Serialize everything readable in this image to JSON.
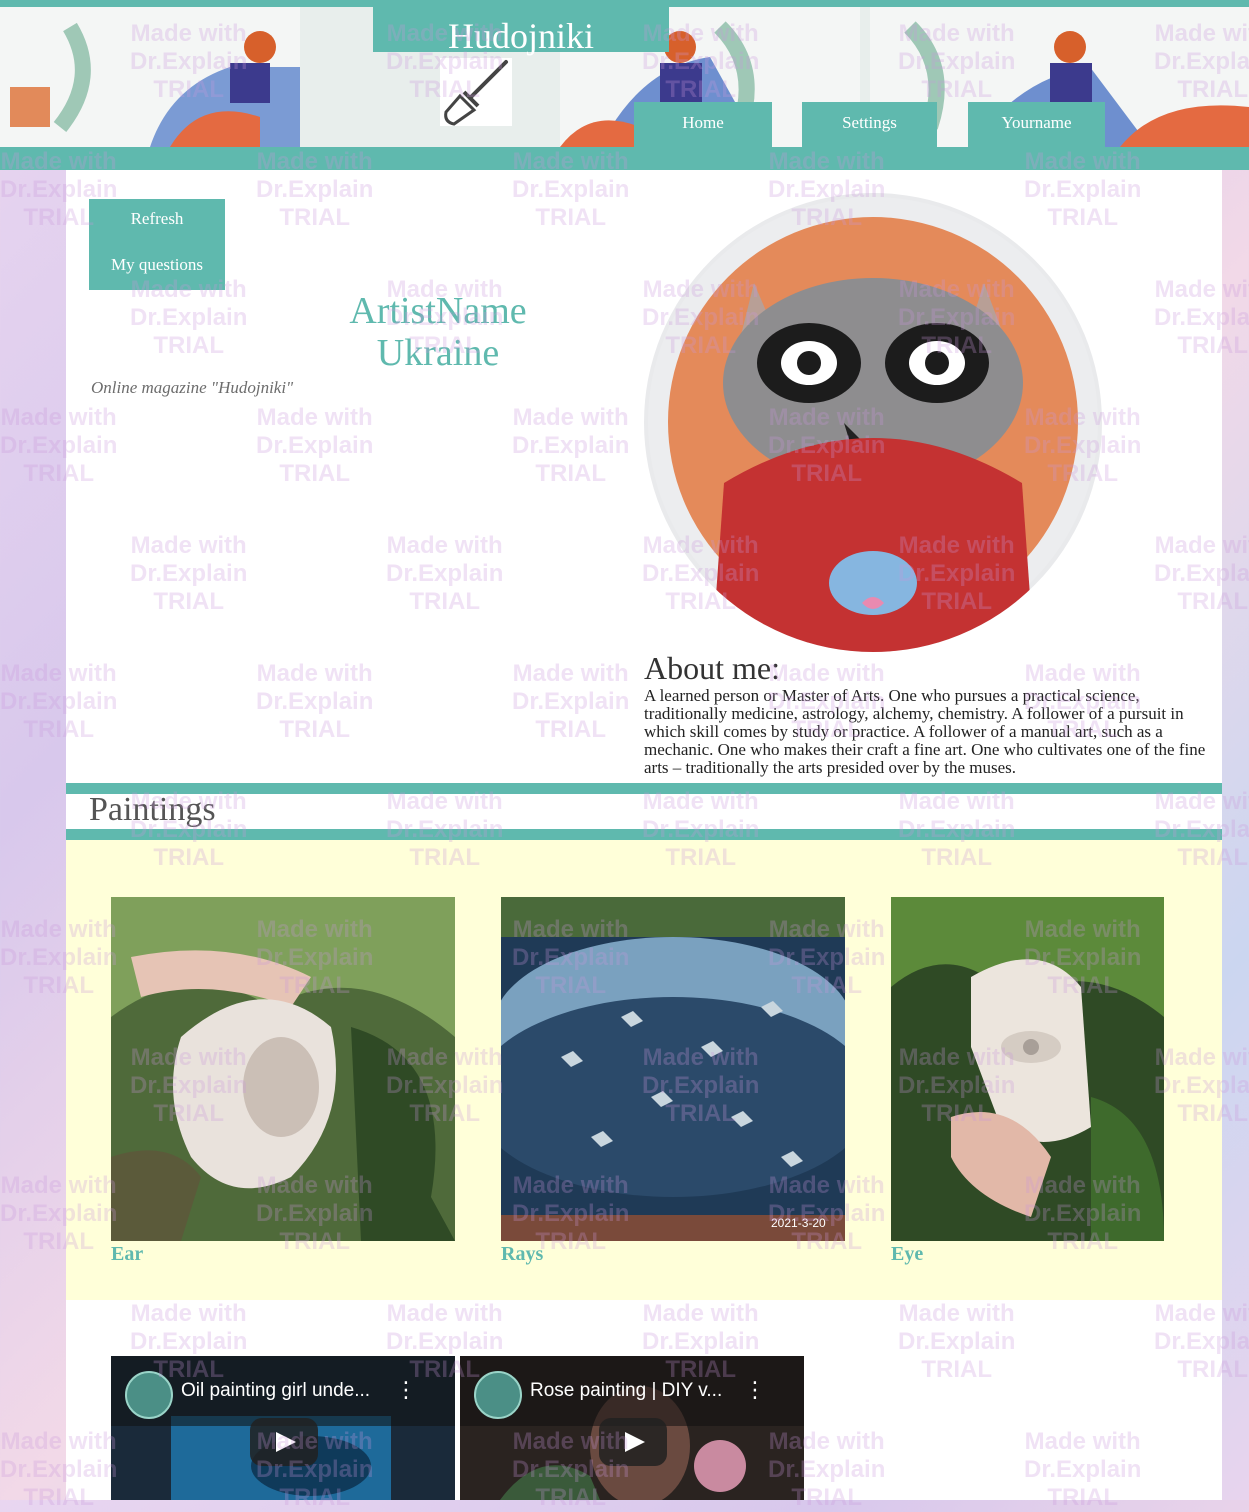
{
  "header": {
    "site_title": "Hudojniki",
    "nav": [
      {
        "label": "Home"
      },
      {
        "label": "Settings"
      },
      {
        "label": "Yourname"
      }
    ]
  },
  "sidebar": {
    "items": [
      {
        "label": "Refresh"
      },
      {
        "label": "My questions"
      }
    ]
  },
  "profile": {
    "artist_name": "ArtistName",
    "country": "Ukraine",
    "magazine": "Online magazine \"Hudojniki\""
  },
  "about": {
    "title": "About me:",
    "text": "A learned person or Master of Arts. One who pursues a practical science, traditionally medicine, astrology, alchemy, chemistry. A follower of a pursuit in which skill comes by study or practice. A follower of a manual art, such as a mechanic. One who makes their craft a fine art. One who cultivates one of the fine arts – traditionally the arts presided over by the muses."
  },
  "paintings": {
    "title": "Paintings",
    "items": [
      {
        "caption": "Ear"
      },
      {
        "caption": "Rays",
        "stamp": "2021-3-20"
      },
      {
        "caption": "Eye"
      }
    ]
  },
  "videos": [
    {
      "title": "Oil painting girl unde..."
    },
    {
      "title": "Rose painting | DIY v..."
    }
  ],
  "watermark": {
    "line1": "Made with",
    "line2": "Dr.Explain",
    "line3": "TRIAL"
  },
  "colors": {
    "accent": "#5fb9ae",
    "gallery_bg": "#ffffd9"
  },
  "icons": [
    "paintbrush-icon",
    "play-icon",
    "more-vert-icon"
  ]
}
